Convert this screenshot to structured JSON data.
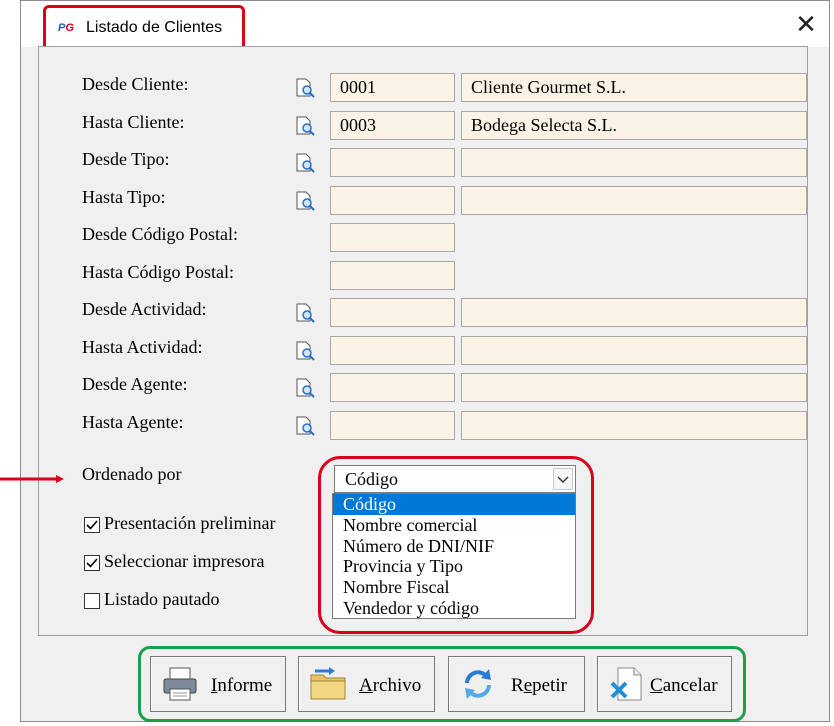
{
  "window": {
    "title": "Listado de Clientes",
    "app_icon_p": "P",
    "app_icon_g": "G",
    "close_glyph": "✕"
  },
  "filters": [
    {
      "label": "Desde Cliente:",
      "code": "0001",
      "name": "Cliente Gourmet S.L.",
      "lookup": true
    },
    {
      "label": "Hasta Cliente:",
      "code": "0003",
      "name": "Bodega Selecta S.L.",
      "lookup": true
    },
    {
      "label": "Desde Tipo:",
      "code": "",
      "name": "",
      "lookup": true
    },
    {
      "label": "Hasta Tipo:",
      "code": "",
      "name": "",
      "lookup": true
    },
    {
      "label": "Desde Código Postal:",
      "code": "",
      "lookup": false
    },
    {
      "label": "Hasta Código Postal:",
      "code": "",
      "lookup": false
    },
    {
      "label": "Desde Actividad:",
      "code": "",
      "name": "",
      "lookup": true
    },
    {
      "label": "Hasta Actividad:",
      "code": "",
      "name": "",
      "lookup": true
    },
    {
      "label": "Desde Agente:",
      "code": "",
      "name": "",
      "lookup": true
    },
    {
      "label": "Hasta Agente:",
      "code": "",
      "name": "",
      "lookup": true
    }
  ],
  "order": {
    "label": "Ordenado por",
    "selected": "Código",
    "options": [
      "Código",
      "Nombre comercial",
      "Número de DNI/NIF",
      "Provincia y Tipo",
      "Nombre Fiscal",
      "Vendedor y código"
    ]
  },
  "checkboxes": [
    {
      "label": "Presentación preliminar",
      "checked": true
    },
    {
      "label": "Seleccionar impresora",
      "checked": true
    },
    {
      "label": "Listado pautado",
      "checked": false
    }
  ],
  "buttons": {
    "informe": {
      "mnemonic": "I",
      "rest": "nforme"
    },
    "archivo": {
      "mnemonic": "A",
      "rest": "rchivo"
    },
    "repetir": {
      "pre": "R",
      "mnemonic": "e",
      "rest": "petir"
    },
    "cancelar": {
      "mnemonic": "C",
      "rest": "ancelar"
    }
  },
  "colors": {
    "highlight_red": "#d9001a",
    "highlight_green": "#18a04a",
    "selection": "#0078d7",
    "field_bg": "#fbf3e6"
  }
}
